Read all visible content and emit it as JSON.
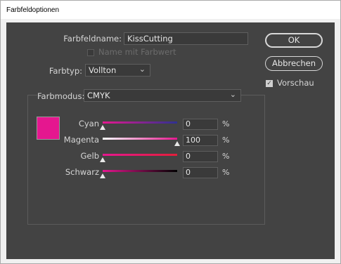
{
  "window": {
    "title": "Farbfeldoptionen"
  },
  "form": {
    "name_label": "Farbfeldname:",
    "name_value": "KissCutting",
    "name_with_value_label": "Name mit Farbwert",
    "type_label": "Farbtyp:",
    "type_value": "Vollton",
    "mode_label": "Farbmodus:",
    "mode_value": "CMYK"
  },
  "buttons": {
    "ok": "OK",
    "cancel": "Abbrechen"
  },
  "preview": {
    "label": "Vorschau",
    "checked": true
  },
  "swatch": {
    "color": "#e5178f"
  },
  "sliders": [
    {
      "label": "Cyan",
      "value": "0",
      "unit": "%",
      "fraction": 0.0
    },
    {
      "label": "Magenta",
      "value": "100",
      "unit": "%",
      "fraction": 1.0
    },
    {
      "label": "Gelb",
      "value": "0",
      "unit": "%",
      "fraction": 0.0
    },
    {
      "label": "Schwarz",
      "value": "0",
      "unit": "%",
      "fraction": 0.0
    }
  ]
}
